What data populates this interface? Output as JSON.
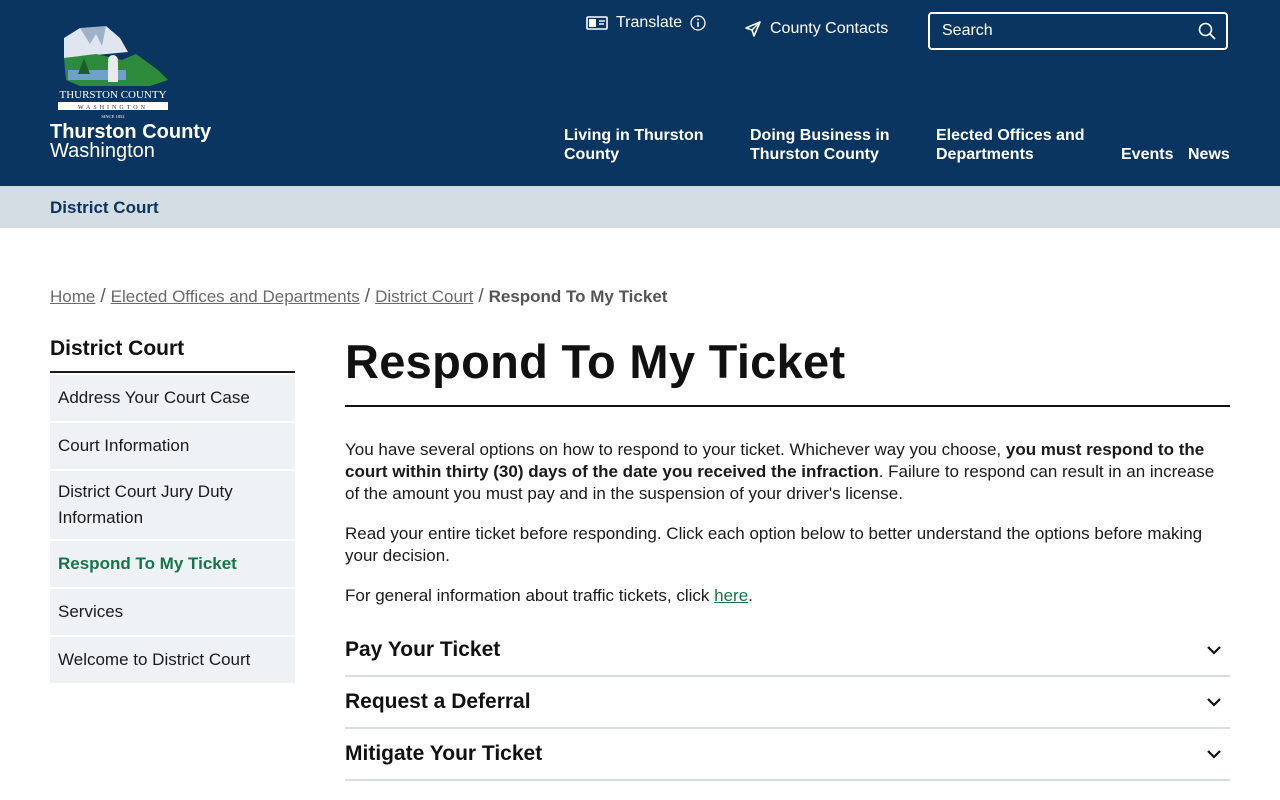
{
  "header": {
    "logo_text": "THURSTON COUNTY",
    "logo_subtext": "WASHINGTON",
    "logo_since": "SINCE 1852",
    "site_name_line1": "Thurston County",
    "site_name_line2": "Washington",
    "translate_label": "Translate",
    "contacts_label": "County Contacts",
    "search_placeholder": "Search",
    "nav": [
      {
        "label": "Living in Thurston\nCounty"
      },
      {
        "label": "Doing Business in\nThurston County"
      },
      {
        "label": "Elected Offices and\nDepartments"
      },
      {
        "label": "Events"
      },
      {
        "label": "News"
      }
    ]
  },
  "dept_bar": {
    "label": "District Court"
  },
  "breadcrumb": {
    "items": [
      "Home",
      "Elected Offices and Departments",
      "District Court"
    ],
    "separator": "/",
    "current": "Respond To My Ticket"
  },
  "sidebar": {
    "title": "District Court",
    "items": [
      {
        "label": "Address Your Court Case"
      },
      {
        "label": "Court Information"
      },
      {
        "label": "District Court Jury Duty Information"
      },
      {
        "label": "Respond To My Ticket"
      },
      {
        "label": "Services"
      },
      {
        "label": "Welcome to District Court"
      }
    ]
  },
  "main": {
    "title": "Respond To My Ticket",
    "para1_start": "You have several options on how to respond to your ticket. Whichever way you choose, ",
    "para1_bold": "you must respond to the court within thirty (30) days of the date you received the infraction",
    "para1_end": ". Failure to respond can result in an increase of the amount you must pay and in the suspension of your driver's license.",
    "para2": "Read your entire ticket before responding. Click each option below to better understand the options before making your decision.",
    "para3_start": "For general information about traffic tickets, click ",
    "para3_link": "here",
    "para3_end": ".",
    "accordion": [
      {
        "label": "Pay Your Ticket"
      },
      {
        "label": "Request a Deferral"
      },
      {
        "label": "Mitigate Your Ticket"
      }
    ]
  },
  "colors": {
    "header_bg": "#0a3560",
    "dept_bar_bg": "#d5dde4",
    "sidebar_item_bg": "#eef2f5",
    "active_green": "#14754a"
  }
}
